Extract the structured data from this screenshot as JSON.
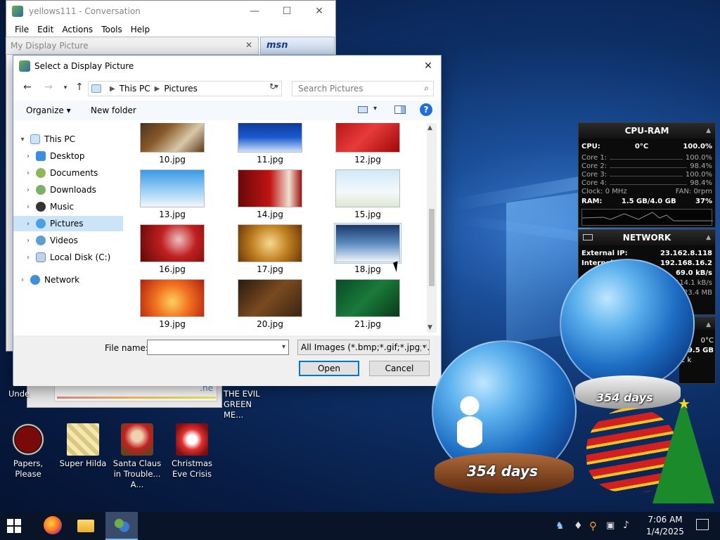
{
  "conversation": {
    "title": "yellows111 - Conversation",
    "menu": [
      "File",
      "Edit",
      "Actions",
      "Tools",
      "Help"
    ],
    "display_picture_title": "My Display Picture",
    "msn_logo": "msn"
  },
  "dialog": {
    "title": "Select a Display Picture",
    "breadcrumb": [
      "This PC",
      "Pictures"
    ],
    "search_placeholder": "Search Pictures",
    "organize_label": "Organize",
    "new_folder_label": "New folder",
    "tree": [
      {
        "label": "This PC",
        "level": 0,
        "expanded": true
      },
      {
        "label": "Desktop",
        "level": 1
      },
      {
        "label": "Documents",
        "level": 1
      },
      {
        "label": "Downloads",
        "level": 1
      },
      {
        "label": "Music",
        "level": 1
      },
      {
        "label": "Pictures",
        "level": 1,
        "selected": true
      },
      {
        "label": "Videos",
        "level": 1
      },
      {
        "label": "Local Disk (C:)",
        "level": 1
      },
      {
        "label": "Network",
        "level": 0
      }
    ],
    "files": [
      "10.jpg",
      "11.jpg",
      "12.jpg",
      "13.jpg",
      "14.jpg",
      "15.jpg",
      "16.jpg",
      "17.jpg",
      "18.jpg",
      "19.jpg",
      "20.jpg",
      "21.jpg"
    ],
    "selected_file": "18.jpg",
    "file_name_label": "File name:",
    "file_name_value": "",
    "file_type_filter": "All Images (*.bmp;*.gif;*.jpg;*.jp",
    "open_label": "Open",
    "cancel_label": "Cancel"
  },
  "gadget_cpu": {
    "title": "CPU-RAM",
    "cpu_label": "CPU:",
    "cpu_temp": "0°C",
    "cpu_value": "100.0%",
    "cores": [
      {
        "label": "Core 1:",
        "value": "100.0%"
      },
      {
        "label": "Core 2:",
        "value": "98.4%"
      },
      {
        "label": "Core 3:",
        "value": "100.0%"
      },
      {
        "label": "Core 4:",
        "value": "98.4%"
      }
    ],
    "clock": "Clock: 0 MHz",
    "fan": "FAN: 0rpm",
    "ram_label": "RAM:",
    "ram_usage": "1.5 GB/4.0 GB",
    "ram_percent": "37%"
  },
  "gadget_network": {
    "title": "NETWORK",
    "external_ip_label": "External IP:",
    "external_ip": "23.162.8.118",
    "internal_label": "Internal",
    "internal_ip": "192.168.16.2",
    "speed_1": "69.0 kB/s",
    "speed_2": "114.1 kB/s",
    "size_1": "23.4 MB"
  },
  "gadget_small": {
    "temp": "0°C",
    "size": "9.5 GB",
    "speed_fragment": "2 k"
  },
  "snowglobe": {
    "days_label_1": "354 days",
    "days_label_2": "354 days"
  },
  "desktop_icons": [
    {
      "label": "Papers, Please"
    },
    {
      "label": "Super Hilda"
    },
    {
      "label": "Santa Claus in Trouble... A..."
    },
    {
      "label": "Christmas Eve Crisis"
    }
  ],
  "desktop_partial_labels": {
    "left": "Unde",
    "evil": "THE EVIL GREEN ME..."
  },
  "behind_window_text": ".ne",
  "taskbar": {
    "time": "7:06 AM",
    "date": "1/4/2025"
  },
  "colors": {
    "dialog_border": "#6b8ed6",
    "selection": "#cce4f7",
    "accent": "#0078d7"
  }
}
